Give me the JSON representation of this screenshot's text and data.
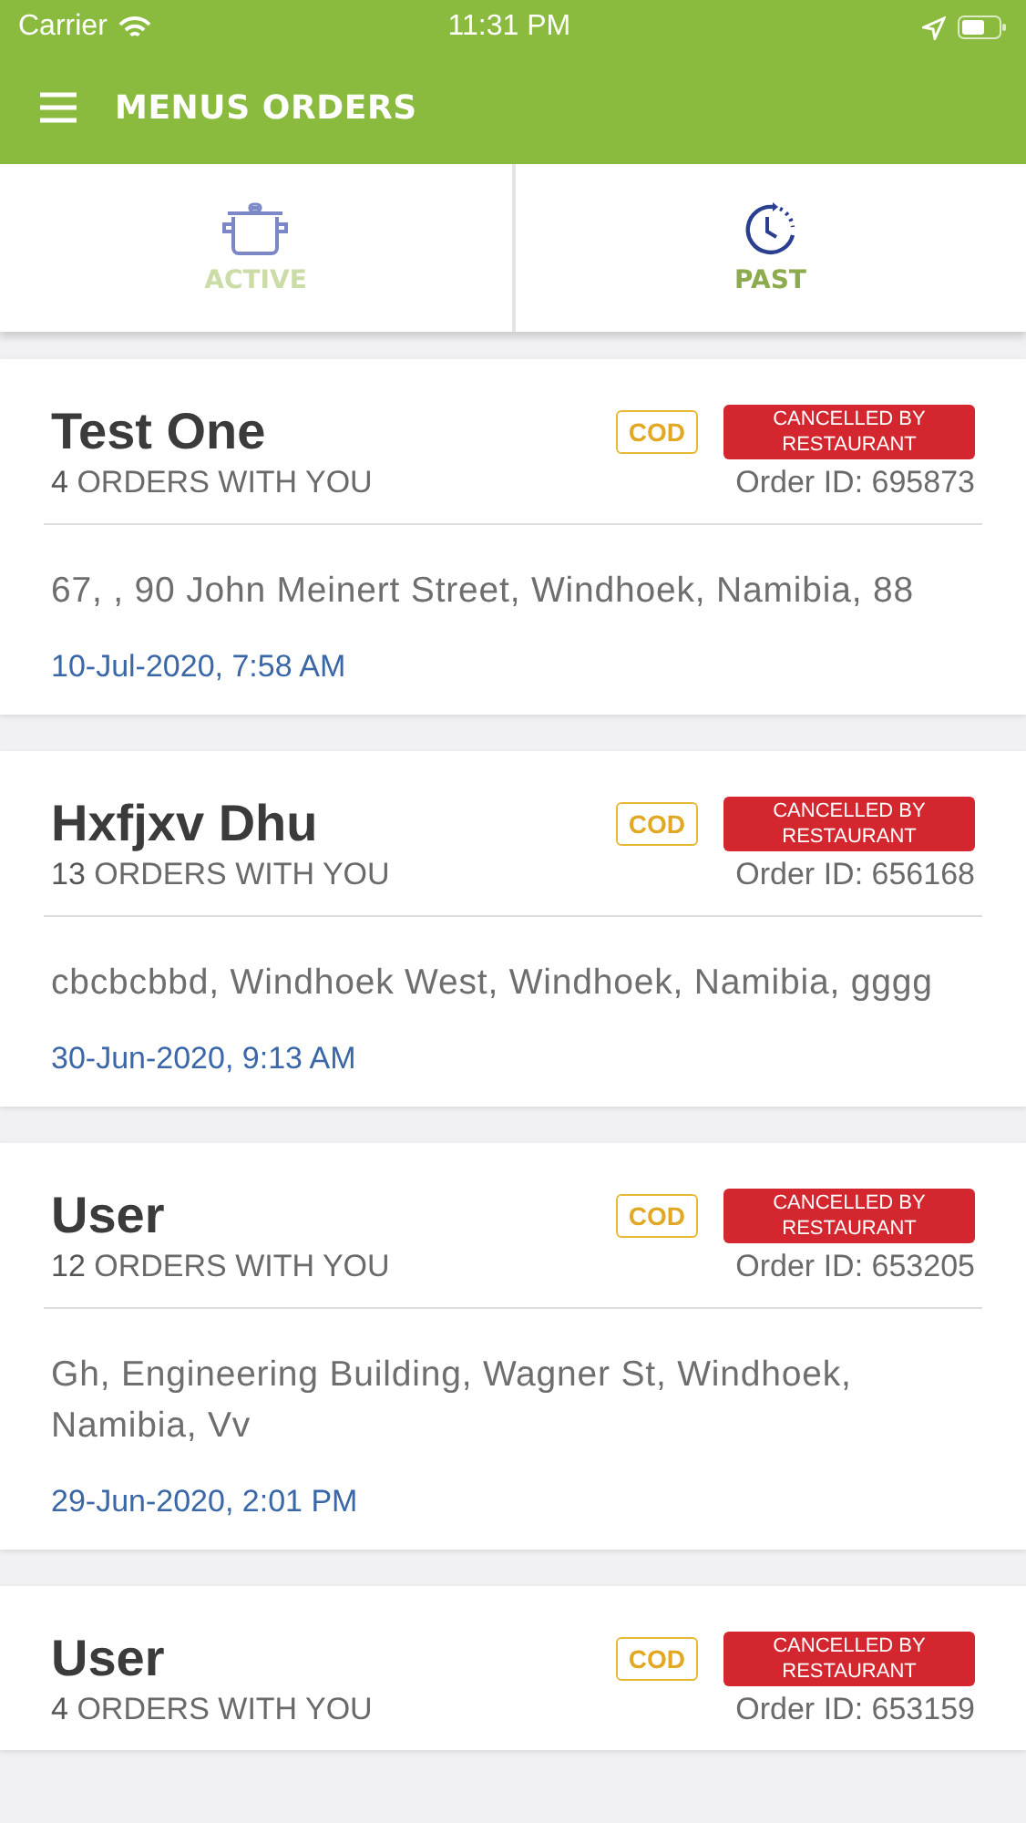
{
  "status_bar": {
    "carrier": "Carrier",
    "time": "11:31 PM"
  },
  "header": {
    "title": "MENUS ORDERS"
  },
  "tabs": [
    {
      "label": "ACTIVE",
      "selected": false
    },
    {
      "label": "PAST",
      "selected": true
    }
  ],
  "orders": [
    {
      "name": "Test One",
      "count": "4",
      "count_label": "ORDERS WITH YOU",
      "payment": "COD",
      "status": "CANCELLED BY RESTAURANT",
      "order_id": "Order ID: 695873",
      "address": "67, , 90 John Meinert Street, Windhoek, Namibia,  88",
      "date": "10-Jul-2020, 7:58 AM"
    },
    {
      "name": "Hxfjxv Dhu",
      "count": "13",
      "count_label": "ORDERS WITH YOU",
      "payment": "COD",
      "status": "CANCELLED BY RESTAURANT",
      "order_id": "Order ID: 656168",
      "address": "cbcbcbbd, Windhoek West, Windhoek, Namibia, gggg",
      "date": "30-Jun-2020, 9:13 AM"
    },
    {
      "name": "User",
      "count": "12",
      "count_label": "ORDERS WITH YOU",
      "payment": "COD",
      "status": "CANCELLED BY RESTAURANT",
      "order_id": "Order ID: 653205",
      "address": "Gh, Engineering Building, Wagner St, Windhoek, Namibia,  Vv",
      "date": "29-Jun-2020, 2:01 PM"
    },
    {
      "name": "User",
      "count": "4",
      "count_label": "ORDERS WITH YOU",
      "payment": "COD",
      "status": "CANCELLED BY RESTAURANT",
      "order_id": "Order ID: 653159"
    }
  ]
}
